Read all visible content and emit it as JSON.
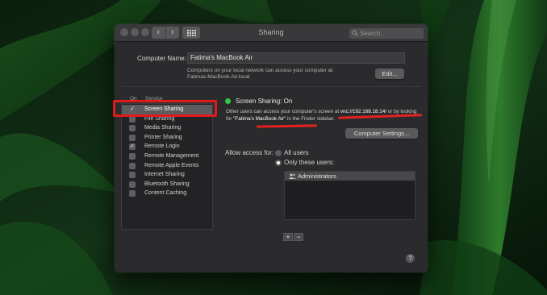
{
  "window": {
    "title": "Sharing",
    "search_placeholder": "Search",
    "nav_back": "‹",
    "nav_forward": "›"
  },
  "computer_name": {
    "label": "Computer Name:",
    "value": "Fatima's MacBook Air",
    "note_line1": "Computers on your local network can access your computer at:",
    "note_line2": "Fatimas-MacBook-Air.local",
    "edit_button": "Edit..."
  },
  "services": {
    "col_on": "On",
    "col_service": "Service",
    "items": [
      {
        "name": "Screen Sharing",
        "checked": true,
        "selected": true
      },
      {
        "name": "File Sharing",
        "checked": false
      },
      {
        "name": "Media Sharing",
        "checked": false
      },
      {
        "name": "Printer Sharing",
        "checked": false
      },
      {
        "name": "Remote Login",
        "checked": true
      },
      {
        "name": "Remote Management",
        "checked": false
      },
      {
        "name": "Remote Apple Events",
        "checked": false
      },
      {
        "name": "Internet Sharing",
        "checked": false
      },
      {
        "name": "Bluetooth Sharing",
        "checked": false
      },
      {
        "name": "Content Caching",
        "checked": false
      }
    ]
  },
  "status": {
    "label": "Screen Sharing: On",
    "color": "#35c84a",
    "desc_part1": "Other users can access your computer's screen at ",
    "vnc_address": "vnc://192.168.18.14/",
    "desc_part2": " or by looking for ",
    "finder_name": "\"Fatima's MacBook Air\"",
    "desc_part3": " in the Finder sidebar.",
    "settings_button": "Computer Settings..."
  },
  "access": {
    "label": "Allow access for:",
    "option_all": "All users",
    "option_only": "Only these users:",
    "users": [
      "Administrators"
    ],
    "add_label": "+",
    "remove_label": "−"
  },
  "help_label": "?",
  "annotation_color": "#e11b1b"
}
